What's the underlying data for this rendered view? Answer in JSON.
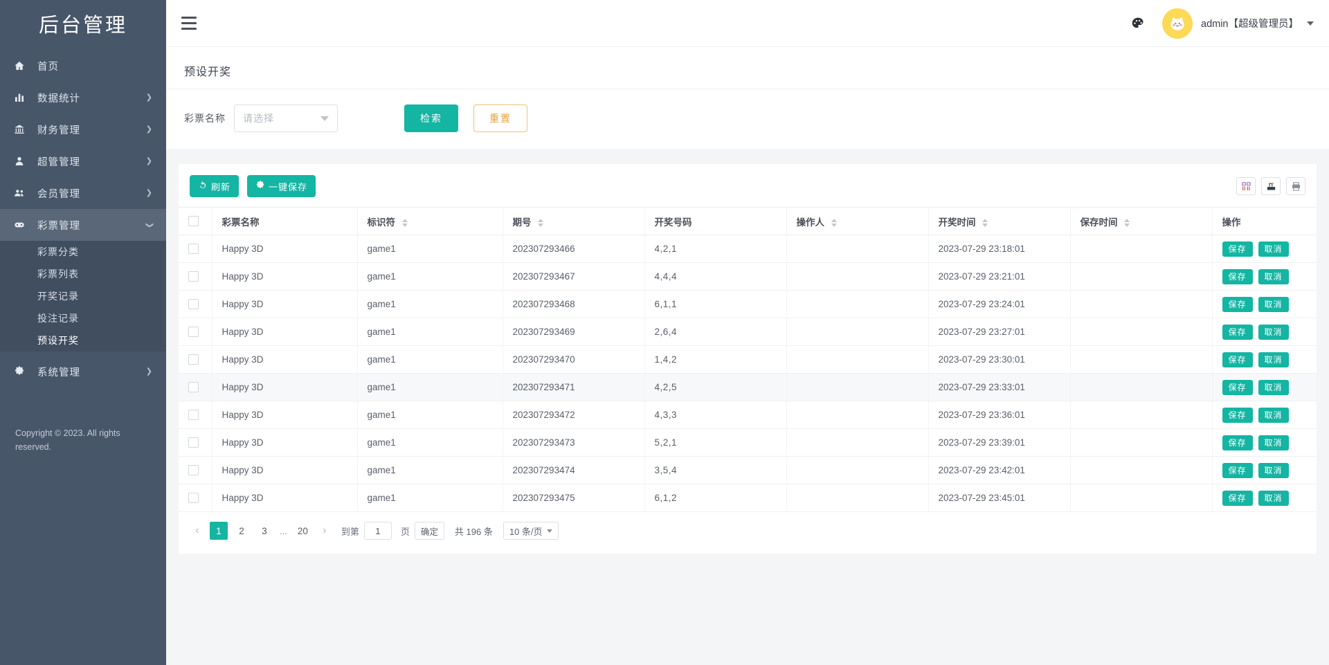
{
  "brand": {
    "title": "后台管理"
  },
  "sidebar": {
    "items": [
      {
        "label": "首页",
        "icon": "home-icon",
        "arrow": false
      },
      {
        "label": "数据统计",
        "icon": "chart-bar-icon",
        "arrow": true
      },
      {
        "label": "财务管理",
        "icon": "bank-icon",
        "arrow": true
      },
      {
        "label": "超管管理",
        "icon": "user-icon",
        "arrow": true
      },
      {
        "label": "会员管理",
        "icon": "users-icon",
        "arrow": true
      },
      {
        "label": "彩票管理",
        "icon": "gamepad-icon",
        "arrow": true,
        "active": true,
        "expanded": true
      },
      {
        "label": "系统管理",
        "icon": "gear-icon",
        "arrow": true
      }
    ],
    "submenu": [
      {
        "label": "彩票分类"
      },
      {
        "label": "彩票列表"
      },
      {
        "label": "开奖记录"
      },
      {
        "label": "投注记录"
      },
      {
        "label": "预设开奖",
        "current": true
      }
    ],
    "copyright": "Copyright © 2023. All rights reserved."
  },
  "topbar": {
    "menu_toggle": "collapse-menu",
    "palette_icon": "palette-icon",
    "username": "admin【超级管理员】"
  },
  "page": {
    "title": "预设开奖",
    "filter": {
      "label": "彩票名称",
      "select_placeholder": "请选择",
      "search_button": "检索",
      "reset_button": "重置"
    }
  },
  "toolbar": {
    "refresh_label": "刷新",
    "save_all_label": "一键保存",
    "columns_icon": "columns-icon",
    "export_icon": "export-icon",
    "print_icon": "print-icon"
  },
  "table": {
    "columns": [
      {
        "key": "checkbox",
        "label": "",
        "sortable": false
      },
      {
        "key": "name",
        "label": "彩票名称",
        "sortable": false
      },
      {
        "key": "code",
        "label": "标识符",
        "sortable": true
      },
      {
        "key": "issue",
        "label": "期号",
        "sortable": true
      },
      {
        "key": "numbers",
        "label": "开奖号码",
        "sortable": false
      },
      {
        "key": "operator",
        "label": "操作人",
        "sortable": true
      },
      {
        "key": "draw_time",
        "label": "开奖时间",
        "sortable": true
      },
      {
        "key": "save_time",
        "label": "保存时间",
        "sortable": true
      },
      {
        "key": "actions",
        "label": "操作",
        "sortable": false
      }
    ],
    "row_actions": {
      "save": "保存",
      "cancel": "取消"
    },
    "rows": [
      {
        "name": "Happy 3D",
        "code": "game1",
        "issue": "202307293466",
        "numbers": "4,2,1",
        "operator": "",
        "draw_time": "2023-07-29 23:18:01",
        "save_time": ""
      },
      {
        "name": "Happy 3D",
        "code": "game1",
        "issue": "202307293467",
        "numbers": "4,4,4",
        "operator": "",
        "draw_time": "2023-07-29 23:21:01",
        "save_time": ""
      },
      {
        "name": "Happy 3D",
        "code": "game1",
        "issue": "202307293468",
        "numbers": "6,1,1",
        "operator": "",
        "draw_time": "2023-07-29 23:24:01",
        "save_time": ""
      },
      {
        "name": "Happy 3D",
        "code": "game1",
        "issue": "202307293469",
        "numbers": "2,6,4",
        "operator": "",
        "draw_time": "2023-07-29 23:27:01",
        "save_time": ""
      },
      {
        "name": "Happy 3D",
        "code": "game1",
        "issue": "202307293470",
        "numbers": "1,4,2",
        "operator": "",
        "draw_time": "2023-07-29 23:30:01",
        "save_time": ""
      },
      {
        "name": "Happy 3D",
        "code": "game1",
        "issue": "202307293471",
        "numbers": "4,2,5",
        "operator": "",
        "draw_time": "2023-07-29 23:33:01",
        "save_time": "",
        "hovered": true
      },
      {
        "name": "Happy 3D",
        "code": "game1",
        "issue": "202307293472",
        "numbers": "4,3,3",
        "operator": "",
        "draw_time": "2023-07-29 23:36:01",
        "save_time": ""
      },
      {
        "name": "Happy 3D",
        "code": "game1",
        "issue": "202307293473",
        "numbers": "5,2,1",
        "operator": "",
        "draw_time": "2023-07-29 23:39:01",
        "save_time": ""
      },
      {
        "name": "Happy 3D",
        "code": "game1",
        "issue": "202307293474",
        "numbers": "3,5,4",
        "operator": "",
        "draw_time": "2023-07-29 23:42:01",
        "save_time": ""
      },
      {
        "name": "Happy 3D",
        "code": "game1",
        "issue": "202307293475",
        "numbers": "6,1,2",
        "operator": "",
        "draw_time": "2023-07-29 23:45:01",
        "save_time": ""
      }
    ]
  },
  "pagination": {
    "prev_icon": "chevron-left-icon",
    "next_icon": "chevron-right-icon",
    "pages": [
      "1",
      "2",
      "3"
    ],
    "ellipsis": "...",
    "last_page": "20",
    "current_page": "1",
    "goto_label": "到第",
    "goto_value": "1",
    "page_unit": "页",
    "confirm_label": "确定",
    "total_label": "共 196 条",
    "page_size_label": "10 条/页"
  },
  "colors": {
    "accent": "#14b5a2",
    "sidebar": "#48566a",
    "submenu": "#404e60",
    "warning": "#e6a23c",
    "number_red": "#f03e3e",
    "avatar_bg": "#fcd956"
  }
}
